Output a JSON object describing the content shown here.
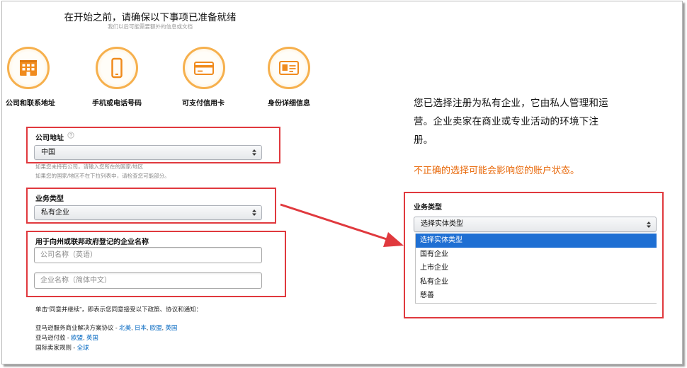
{
  "header": {
    "title": "在开始之前，请确保以下事项已准备就绪",
    "subtitle": "我们以后可能需要额外的信息或文档"
  },
  "requirements": [
    {
      "icon": "building-icon",
      "label": "公司和联系地址"
    },
    {
      "icon": "mobile-phone-icon",
      "label": "手机或电话号码"
    },
    {
      "icon": "credit-card-icon",
      "label": "可支付信用卡"
    },
    {
      "icon": "id-card-icon",
      "label": "身份详细信息"
    }
  ],
  "form": {
    "company_address": {
      "label": "公司地址",
      "help_icon": "help-circle-icon",
      "value": "中国",
      "help_lines": [
        "如果您未持有公司，请输入您所在的国家/地区",
        "如果您的国家/地区不在下拉列表中，请检查您可能部分。"
      ]
    },
    "business_type": {
      "label": "业务类型",
      "value": "私有企业"
    },
    "business_name": {
      "label": "用于向州或联邦政府登记的企业名称",
      "placeholder_en": "公司名称（英语）",
      "placeholder_zh": "企业名称（简体中文）"
    },
    "agreement_text": "单击“同意并继续”，即表示您同意接受以下政策、协议和通知：",
    "name_separator": " - ",
    "link_separator": ", ",
    "policies": [
      {
        "name": "亚马逊服务商业解决方案协议",
        "links": [
          "北美",
          "日本",
          "欧盟",
          "英国"
        ]
      },
      {
        "name": "亚马逊付款",
        "links": [
          "欧盟",
          "英国"
        ]
      },
      {
        "name": "国际卖家规则",
        "links": [
          "全球"
        ]
      }
    ]
  },
  "right_panel": {
    "description": "您已选择注册为私有企业，它由私人管理和运营。企业卖家在商业或专业活动的环境下注册。",
    "warning": "不正确的选择可能会影响您的账户状态。",
    "business_type": {
      "label": "业务类型",
      "value": "选择实体类型",
      "options": [
        "选择实体类型",
        "国有企业",
        "上市企业",
        "私有企业",
        "慈善"
      ],
      "highlighted_index": 0
    }
  },
  "colors": {
    "annotation_red": "#e0393e",
    "accent_orange": "#f08b1d",
    "ring_orange": "#f6b04d",
    "warning_orange": "#e8690b",
    "link_blue": "#0066c0",
    "highlight_blue": "#1e6fd3"
  }
}
